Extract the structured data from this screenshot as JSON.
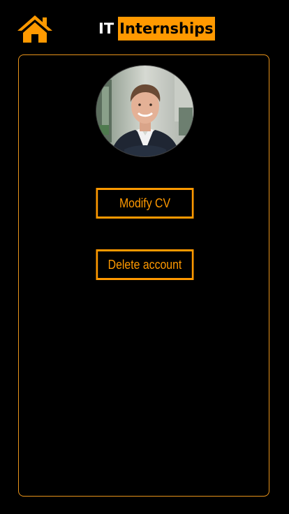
{
  "header": {
    "home_icon": "home-icon",
    "logo_prefix": "IT",
    "logo_highlight": "Internships"
  },
  "profile": {
    "avatar_alt": "profile photo"
  },
  "actions": {
    "modify_cv_label": "Modify CV",
    "delete_account_label": "Delete account"
  },
  "colors": {
    "background": "#000000",
    "accent": "#ff9900",
    "card_border": "#e8931a",
    "logo_text": "#ffffff"
  }
}
